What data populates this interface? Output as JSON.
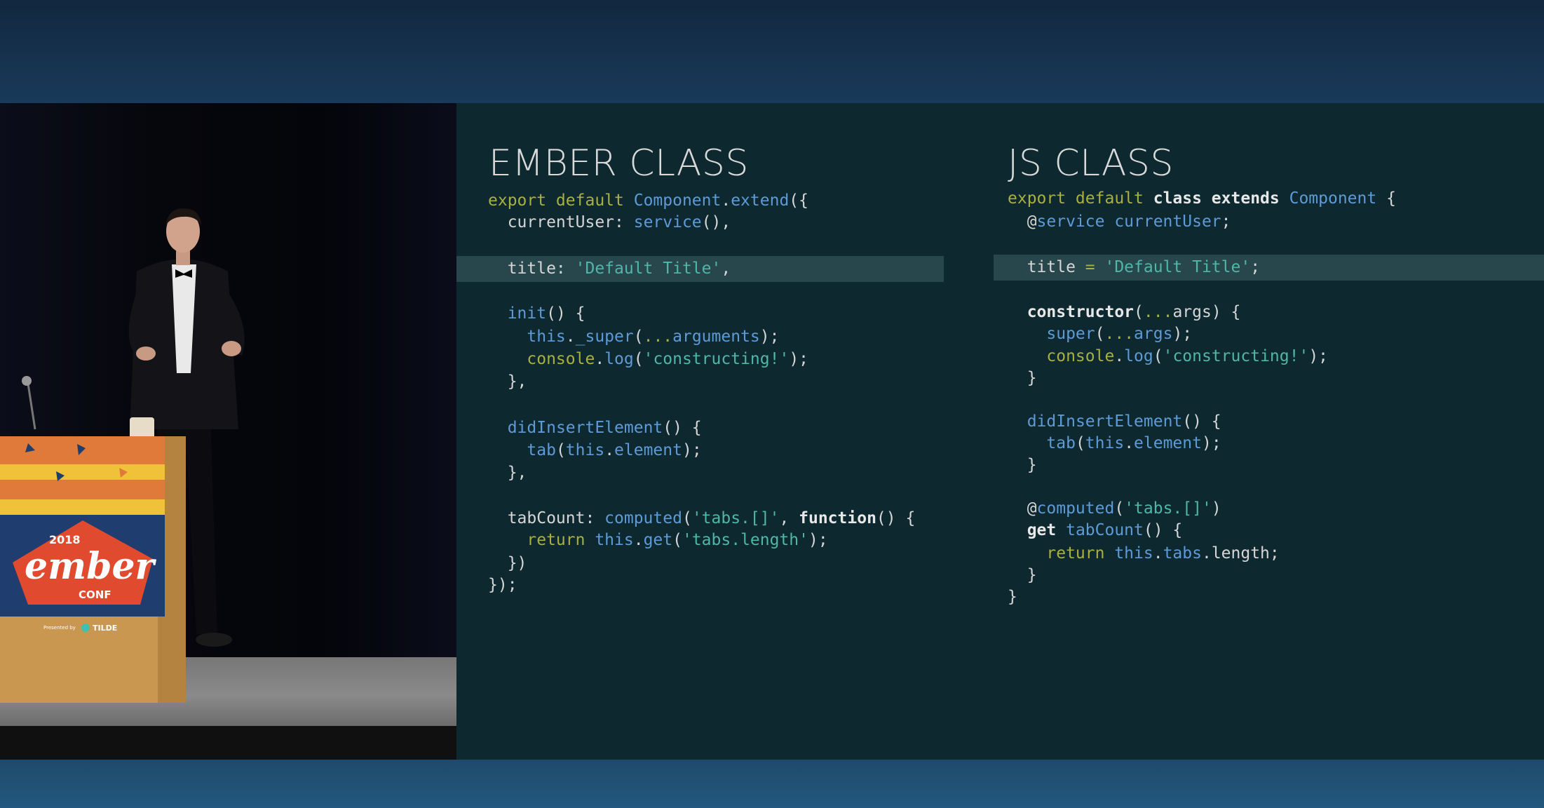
{
  "colors": {
    "slide_background": "#0e2830",
    "highlight_row": "#27474d",
    "keyword": "#a7b040",
    "function": "#5e9bd6",
    "string": "#4fb6a8",
    "text": "#d6d6d6"
  },
  "podium": {
    "year": "2018",
    "logo_word": "ember",
    "logo_sub": "CONF",
    "presented_by": "Presented by",
    "sponsor": "TILDE"
  },
  "slide": {
    "left": {
      "title": "EMBER CLASS",
      "highlight_index": 2,
      "lines": [
        [
          [
            "kw",
            "export default "
          ],
          [
            "fn",
            "Component"
          ],
          [
            "pl",
            "."
          ],
          [
            "fn",
            "extend"
          ],
          [
            "pl",
            "({"
          ]
        ],
        [
          [
            "pl",
            "  currentUser: "
          ],
          [
            "fn",
            "service"
          ],
          [
            "pl",
            "(),"
          ]
        ],
        [
          [
            "pl",
            "  title: "
          ],
          [
            "str",
            "'Default Title'"
          ],
          [
            "pl",
            ","
          ]
        ],
        [
          [
            "pl",
            "  "
          ],
          [
            "fn",
            "init"
          ],
          [
            "pl",
            "() {"
          ]
        ],
        [
          [
            "pl",
            "    "
          ],
          [
            "fn",
            "this"
          ],
          [
            "pl",
            "."
          ],
          [
            "fn",
            "_super"
          ],
          [
            "pl",
            "("
          ],
          [
            "kw",
            "..."
          ],
          [
            "fn",
            "arguments"
          ],
          [
            "pl",
            ");"
          ]
        ],
        [
          [
            "pl",
            "    "
          ],
          [
            "kw",
            "console"
          ],
          [
            "pl",
            "."
          ],
          [
            "fn",
            "log"
          ],
          [
            "pl",
            "("
          ],
          [
            "str",
            "'constructing!'"
          ],
          [
            "pl",
            ");"
          ]
        ],
        [
          [
            "pl",
            "  },"
          ]
        ],
        [
          [
            "pl",
            "  "
          ],
          [
            "fn",
            "didInsertElement"
          ],
          [
            "pl",
            "() {"
          ]
        ],
        [
          [
            "pl",
            "    "
          ],
          [
            "fn",
            "tab"
          ],
          [
            "pl",
            "("
          ],
          [
            "fn",
            "this"
          ],
          [
            "pl",
            "."
          ],
          [
            "fn",
            "element"
          ],
          [
            "pl",
            ");"
          ]
        ],
        [
          [
            "pl",
            "  },"
          ]
        ],
        [
          [
            "pl",
            "  tabCount: "
          ],
          [
            "fn",
            "computed"
          ],
          [
            "pl",
            "("
          ],
          [
            "str",
            "'tabs.[]'"
          ],
          [
            "pl",
            ", "
          ],
          [
            "bold",
            "function"
          ],
          [
            "pl",
            "() {"
          ]
        ],
        [
          [
            "pl",
            "    "
          ],
          [
            "kw",
            "return "
          ],
          [
            "fn",
            "this"
          ],
          [
            "pl",
            "."
          ],
          [
            "fn",
            "get"
          ],
          [
            "pl",
            "("
          ],
          [
            "str",
            "'tabs.length'"
          ],
          [
            "pl",
            ");"
          ]
        ],
        [
          [
            "pl",
            "  })"
          ]
        ],
        [
          [
            "pl",
            "});"
          ]
        ]
      ]
    },
    "right": {
      "title": "JS CLASS",
      "highlight_index": 2,
      "lines": [
        [
          [
            "kw",
            "export default "
          ],
          [
            "bold",
            "class extends "
          ],
          [
            "fn",
            "Component"
          ],
          [
            "pl",
            " {"
          ]
        ],
        [
          [
            "pl",
            "  @"
          ],
          [
            "fn",
            "service currentUser"
          ],
          [
            "pl",
            ";"
          ]
        ],
        [
          [
            "pl",
            "  title "
          ],
          [
            "kw",
            "= "
          ],
          [
            "str",
            "'Default Title'"
          ],
          [
            "pl",
            ";"
          ]
        ],
        [
          [
            "pl",
            "  "
          ],
          [
            "bold",
            "constructor"
          ],
          [
            "pl",
            "("
          ],
          [
            "kw",
            "..."
          ],
          [
            "pl",
            "args) {"
          ]
        ],
        [
          [
            "pl",
            "    "
          ],
          [
            "fn",
            "super"
          ],
          [
            "pl",
            "("
          ],
          [
            "kw",
            "..."
          ],
          [
            "fn",
            "args"
          ],
          [
            "pl",
            ");"
          ]
        ],
        [
          [
            "pl",
            "    "
          ],
          [
            "kw",
            "console"
          ],
          [
            "pl",
            "."
          ],
          [
            "fn",
            "log"
          ],
          [
            "pl",
            "("
          ],
          [
            "str",
            "'constructing!'"
          ],
          [
            "pl",
            ");"
          ]
        ],
        [
          [
            "pl",
            "  }"
          ]
        ],
        [
          [
            "pl",
            "  "
          ],
          [
            "fn",
            "didInsertElement"
          ],
          [
            "pl",
            "() {"
          ]
        ],
        [
          [
            "pl",
            "    "
          ],
          [
            "fn",
            "tab"
          ],
          [
            "pl",
            "("
          ],
          [
            "fn",
            "this"
          ],
          [
            "pl",
            "."
          ],
          [
            "fn",
            "element"
          ],
          [
            "pl",
            ");"
          ]
        ],
        [
          [
            "pl",
            "  }"
          ]
        ],
        [
          [
            "pl",
            "  @"
          ],
          [
            "fn",
            "computed"
          ],
          [
            "pl",
            "("
          ],
          [
            "str",
            "'tabs.[]'"
          ],
          [
            "pl",
            ")"
          ]
        ],
        [
          [
            "pl",
            "  "
          ],
          [
            "bold",
            "get "
          ],
          [
            "fn",
            "tabCount"
          ],
          [
            "pl",
            "() {"
          ]
        ],
        [
          [
            "pl",
            "    "
          ],
          [
            "kw",
            "return "
          ],
          [
            "fn",
            "this"
          ],
          [
            "pl",
            "."
          ],
          [
            "fn",
            "tabs"
          ],
          [
            "pl",
            ".length;"
          ]
        ],
        [
          [
            "pl",
            "  }"
          ]
        ],
        [
          [
            "pl",
            "}"
          ]
        ]
      ]
    }
  }
}
